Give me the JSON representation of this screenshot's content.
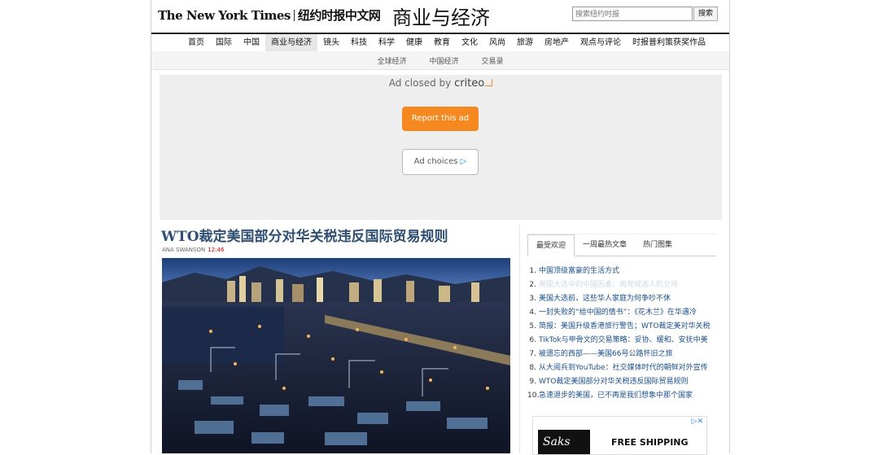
{
  "masthead": {
    "logo_text": "The New York Times",
    "logo_cn": "纽约时报中文网",
    "section_title": "商业与经济",
    "search_placeholder": "搜索纽约时报",
    "search_button": "搜索"
  },
  "main_nav": [
    "首页",
    "国际",
    "中国",
    "商业与经济",
    "镜头",
    "科技",
    "科学",
    "健康",
    "教育",
    "文化",
    "风尚",
    "旅游",
    "房地产",
    "观点与评论",
    "时报普利策获奖作品"
  ],
  "main_nav_active": "商业与经济",
  "sub_nav": [
    "全球经济",
    "中国经济",
    "交易录"
  ],
  "ad": {
    "closed_text": "Ad closed by",
    "closed_brand": "criteo",
    "report_button": "Report this ad",
    "choices_button": "Ad choices",
    "choices_glyph": "▷"
  },
  "article": {
    "headline": "WTO裁定美国部分对华关税违反国际贸易规则",
    "author": "ANA SWANSON",
    "time": "12:46"
  },
  "sidebar": {
    "tabs": [
      "最受欢迎",
      "一周最热文章",
      "热门图集"
    ],
    "active_tab": "最受欢迎",
    "most_popular": [
      {
        "num": "1.",
        "text": "中国顶级富豪的生活方式"
      },
      {
        "num": "2.",
        "text": "美国大选中的中国因素：两党候选人的立场"
      },
      {
        "num": "3.",
        "text": "美国大选前，这些华人家庭为何争吵不休"
      },
      {
        "num": "4.",
        "text": "一封失败的“给中国的情书”：《花木兰》在华遇冷"
      },
      {
        "num": "5.",
        "text": "简报：美国升级香港旅行警告；WTO裁定美对华关税"
      },
      {
        "num": "6.",
        "text": "TikTok与甲骨文的交易策略：妥协、缓和、安抚中美"
      },
      {
        "num": "7.",
        "text": "被遗忘的西部——美国66号公路怀旧之旅"
      },
      {
        "num": "8.",
        "text": "从大阅兵到YouTube：社交媒体时代的朝鲜对外宣传"
      },
      {
        "num": "9.",
        "text": "WTO裁定美国部分对华关税违反国际贸易规则"
      },
      {
        "num": "10.",
        "text": "急速退步的美国，已不再是我们想象中那个国家"
      }
    ],
    "ad": {
      "brand": "Saks",
      "text": "FREE SHIPPING",
      "choice_glyph": "▷✕"
    }
  }
}
